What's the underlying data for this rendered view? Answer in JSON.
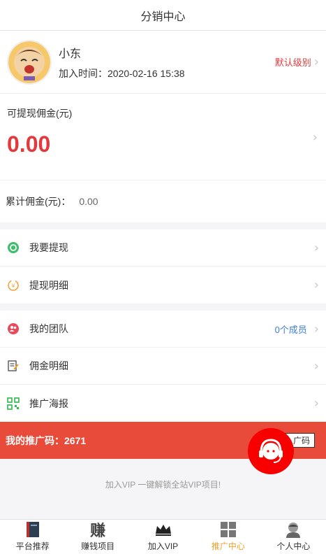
{
  "header": {
    "title": "分销中心"
  },
  "profile": {
    "name": "小东",
    "join_label": "加入时间：",
    "join_time": "2020-02-16 15:38",
    "level": "默认级别"
  },
  "commission": {
    "label": "可提现佣金(元)",
    "amount": "0.00"
  },
  "total": {
    "label": "累计佣金(元)：",
    "value": "0.00"
  },
  "menu_group_1": [
    {
      "label": "我要提现",
      "icon": "withdraw-icon"
    },
    {
      "label": "提现明细",
      "icon": "withdraw-detail-icon"
    }
  ],
  "menu_group_2": [
    {
      "label": "我的团队",
      "icon": "team-icon",
      "extra": "0个成员"
    },
    {
      "label": "佣金明细",
      "icon": "commission-detail-icon"
    },
    {
      "label": "推广海报",
      "icon": "qrcode-icon"
    }
  ],
  "promo": {
    "label": "我的推广码：",
    "code": "2671",
    "button": "一 广码"
  },
  "vip_text": "加入VIP 一键解锁全站VIP项目!",
  "tabbar": [
    {
      "label": "平台推荐",
      "icon": "book-icon",
      "active": false
    },
    {
      "label": "赚钱项目",
      "icon": "earn-icon",
      "glyph": "赚",
      "active": false
    },
    {
      "label": "加入VIP",
      "icon": "crown-icon",
      "active": false
    },
    {
      "label": "推广中心",
      "icon": "grid-icon",
      "active": true
    },
    {
      "label": "个人中心",
      "icon": "person-icon",
      "active": false
    }
  ],
  "colors": {
    "accent_red": "#e4393c",
    "promo_bar": "#e84b3a",
    "active_tab": "#f0a02c",
    "link_blue": "#3d7ee6"
  }
}
